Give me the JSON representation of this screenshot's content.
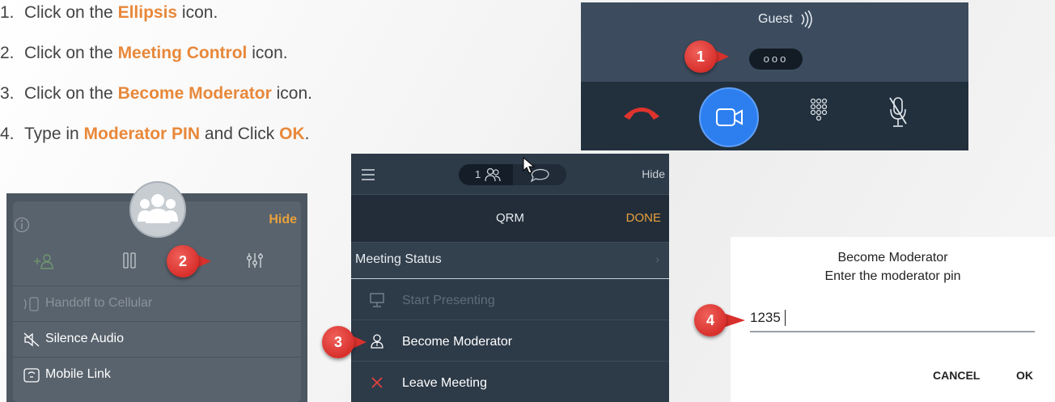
{
  "steps": [
    {
      "num": "1.",
      "pre": "Click on the ",
      "highlight": "Ellipsis",
      "mid": " icon.",
      "highlight2": "",
      "post": ""
    },
    {
      "num": "2.",
      "pre": "Click on the ",
      "highlight": "Meeting Control",
      "mid": " icon.",
      "highlight2": "",
      "post": ""
    },
    {
      "num": "3.",
      "pre": "Click on the ",
      "highlight": "Become Moderator",
      "mid": " icon.",
      "highlight2": "",
      "post": ""
    },
    {
      "num": "4.",
      "pre": "Type in ",
      "highlight": "Moderator PIN",
      "mid": " and Click ",
      "highlight2": "OK",
      "post": "."
    }
  ],
  "markers": [
    "1",
    "2",
    "3",
    "4"
  ],
  "call_panel": {
    "caller": "Guest",
    "signal_icon": "signal-waves-icon",
    "ellipsis_label": "ooo",
    "buttons": [
      "end-call-icon",
      "video-camera-icon",
      "dialpad-icon",
      "mute-microphone-icon"
    ]
  },
  "control_panel": {
    "hide_label": "Hide",
    "items": [
      {
        "label": "Handoff to Cellular",
        "icon": "handoff-icon",
        "enabled": false
      },
      {
        "label": "Silence Audio",
        "icon": "silence-speaker-icon",
        "enabled": true
      },
      {
        "label": "Mobile Link",
        "icon": "mobile-link-icon",
        "enabled": true
      }
    ]
  },
  "meeting_panel": {
    "participant_count": "1",
    "hide_label": "Hide",
    "title": "QRM",
    "done_label": "DONE",
    "status_label": "Meeting Status",
    "items": [
      {
        "label": "Start Presenting",
        "icon": "monitor-icon",
        "enabled": false
      },
      {
        "label": "Become Moderator",
        "icon": "moderator-icon",
        "enabled": true
      },
      {
        "label": "Leave Meeting",
        "icon": "close-x-icon",
        "enabled": true
      }
    ]
  },
  "pin_dialog": {
    "title": "Become Moderator",
    "subtitle": "Enter the moderator pin",
    "pin_value": "1235",
    "cancel_label": "CANCEL",
    "ok_label": "OK"
  },
  "colors": {
    "highlight": "#e8883a",
    "marker": "#d8302c",
    "call_blue": "#2d7ff0",
    "end_red": "#e0332e",
    "leave_red": "#e0433e",
    "orange": "#e8a13c"
  }
}
